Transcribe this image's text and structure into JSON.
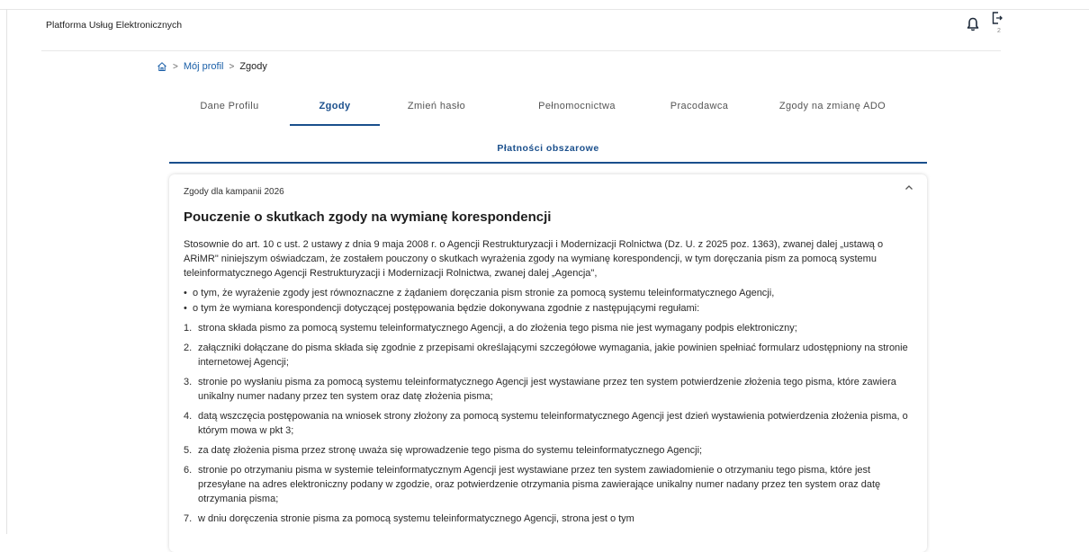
{
  "header": {
    "app_title": "Platforma Usług Elektronicznych",
    "exit_sub": "2"
  },
  "breadcrumb": {
    "items": [
      "Mój profil",
      "Zgody"
    ]
  },
  "tabs": [
    "Dane Profilu",
    "Zgody",
    "Zmień hasło",
    "Pełnomocnictwa",
    "Pracodawca",
    "Zgody na zmianę ADO"
  ],
  "active_tab": "Zgody",
  "subtab": "Płatności obszarowe",
  "card": {
    "subtitle": "Zgody dla kampanii 2026",
    "title": "Pouczenie o skutkach zgody na wymianę korespondencji",
    "intro": "Stosownie do art. 10 c ust. 2 ustawy z dnia 9 maja 2008 r. o Agencji Restrukturyzacji i Modernizacji Rolnictwa (Dz. U. z 2025 poz. 1363), zwanej dalej „ustawą o ARiMR\" niniejszym oświadczam, że zostałem pouczony o skutkach wyrażenia zgody na wymianę korespondencji, w tym doręczania pism za pomocą systemu teleinformatycznego Agencji Restrukturyzacji i Modernizacji Rolnictwa, zwanej dalej „Agencja\",",
    "bullets": [
      "o tym, że wyrażenie zgody jest równoznaczne z żądaniem doręczania pism stronie za pomocą systemu teleinformatycznego Agencji,",
      "o tym że wymiana korespondencji dotyczącej postępowania będzie dokonywana zgodnie z następującymi regułami:"
    ],
    "rules": [
      {
        "n": "1.",
        "text": "strona składa pismo za pomocą systemu teleinformatycznego Agencji, a do złożenia tego pisma nie jest wymagany podpis elektroniczny;"
      },
      {
        "n": "2.",
        "text": "załączniki dołączane do pisma składa się zgodnie z przepisami określającymi szczegółowe wymagania, jakie powinien spełniać formularz udostępniony na stronie internetowej Agencji;"
      },
      {
        "n": "3.",
        "text": "stronie po wysłaniu pisma za pomocą systemu teleinformatycznego Agencji jest wystawiane przez ten system potwierdzenie złożenia tego pisma, które zawiera unikalny numer nadany przez ten system oraz datę złożenia pisma;"
      },
      {
        "n": "4.",
        "text": "datą wszczęcia postępowania na wniosek strony złożony za pomocą systemu teleinformatycznego Agencji jest dzień wystawienia potwierdzenia złożenia pisma, o którym mowa w pkt 3;"
      },
      {
        "n": "5.",
        "text": "za datę złożenia pisma przez stronę uważa się wprowadzenie tego pisma do systemu teleinformatycznego Agencji;"
      },
      {
        "n": "6.",
        "text": "stronie po otrzymaniu pisma w systemie teleinformatycznym Agencji jest wystawiane przez ten system zawiadomienie o otrzymaniu tego pisma, które jest przesyłane na adres elektroniczny podany w zgodzie, oraz potwierdzenie otrzymania pisma zawierające unikalny numer nadany przez ten system oraz datę otrzymania pisma;"
      },
      {
        "n": "7.",
        "text": "w dniu doręczenia stronie pisma za pomocą systemu teleinformatycznego Agencji, strona jest o tym"
      }
    ]
  },
  "colors": {
    "accent": "#1a4f8c",
    "link": "#1a5fa8"
  },
  "icons": [
    "home-icon",
    "bell-icon",
    "logout-icon",
    "chevron-up-icon"
  ]
}
